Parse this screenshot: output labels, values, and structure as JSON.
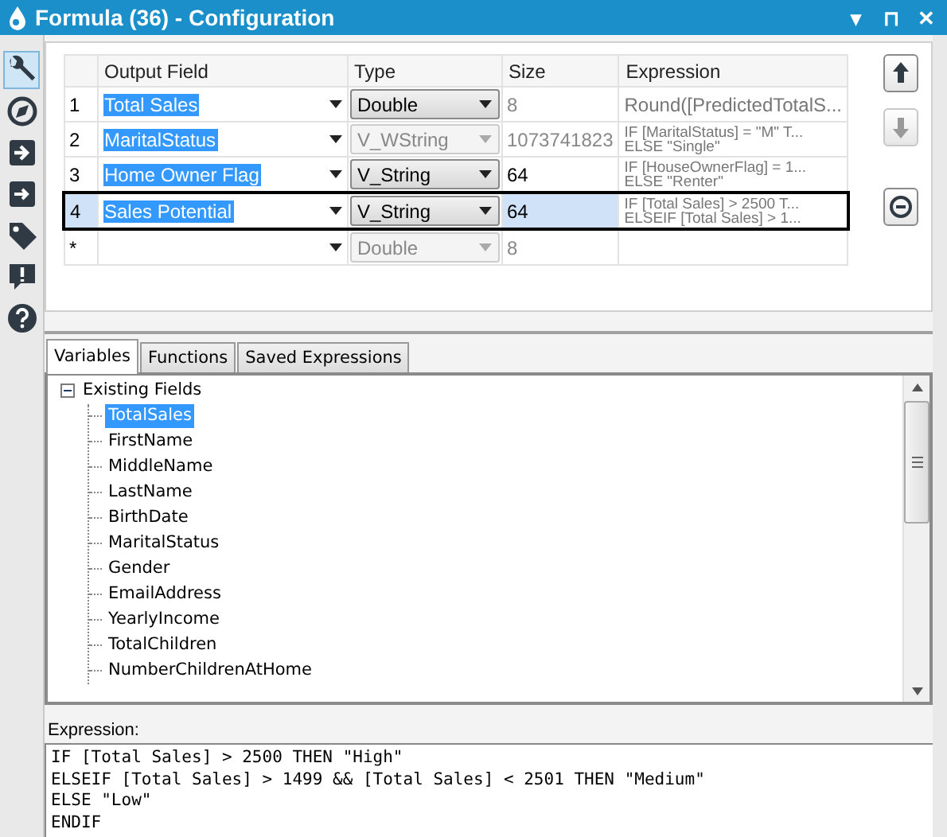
{
  "window": {
    "title": "Formula (36) - Configuration",
    "controls": [
      "▾",
      "⊓",
      "✕"
    ]
  },
  "sidebar": {
    "items": [
      {
        "kind": "wrench",
        "selected": true
      },
      {
        "kind": "compass",
        "selected": false
      },
      {
        "kind": "input",
        "selected": false
      },
      {
        "kind": "output",
        "selected": false
      },
      {
        "kind": "tag",
        "selected": false
      },
      {
        "kind": "alert",
        "selected": false
      },
      {
        "kind": "help",
        "selected": false
      }
    ]
  },
  "table": {
    "columns": [
      "Output Field",
      "Type",
      "Size",
      "Expression"
    ],
    "rows": [
      {
        "number": "1",
        "field": "Total Sales",
        "field_highlighted": true,
        "type": "Double",
        "type_disabled": false,
        "size": "8",
        "size_disabled": true,
        "expression": [
          "Round([PredictedTotalS..."
        ],
        "selected": false
      },
      {
        "number": "2",
        "field": "MaritalStatus",
        "field_highlighted": true,
        "type": "V_WString",
        "type_disabled": true,
        "size": "1073741823",
        "size_disabled": true,
        "expression": [
          "IF [MaritalStatus] = \"M\" T...",
          "ELSE \"Single\""
        ],
        "selected": false
      },
      {
        "number": "3",
        "field": "Home Owner Flag",
        "field_highlighted": true,
        "type": "V_String",
        "type_disabled": false,
        "size": "64",
        "size_disabled": false,
        "expression": [
          "IF [HouseOwnerFlag] = 1...",
          "ELSE \"Renter\""
        ],
        "selected": false
      },
      {
        "number": "4",
        "field": "Sales Potential",
        "field_highlighted": true,
        "type": "V_String",
        "type_disabled": false,
        "size": "64",
        "size_disabled": false,
        "expression": [
          "IF [Total Sales] > 2500 T...",
          "ELSEIF [Total Sales] > 1..."
        ],
        "selected": true
      },
      {
        "number": "*",
        "field": "",
        "field_highlighted": false,
        "type": "Double",
        "type_disabled": true,
        "size": "8",
        "size_disabled": true,
        "expression": [],
        "selected": false
      }
    ]
  },
  "row_buttons": [
    {
      "kind": "up",
      "disabled": false
    },
    {
      "kind": "down",
      "disabled": true
    },
    {
      "kind": "remove",
      "disabled": false
    }
  ],
  "tabs": [
    {
      "label": "Variables",
      "selected": true
    },
    {
      "label": "Functions",
      "selected": false
    },
    {
      "label": "Saved Expressions",
      "selected": false
    }
  ],
  "tree": {
    "label": "Existing Fields",
    "expanded": true,
    "children": [
      {
        "label": "TotalSales",
        "selected": true
      },
      {
        "label": "FirstName",
        "selected": false
      },
      {
        "label": "MiddleName",
        "selected": false
      },
      {
        "label": "LastName",
        "selected": false
      },
      {
        "label": "BirthDate",
        "selected": false
      },
      {
        "label": "MaritalStatus",
        "selected": false
      },
      {
        "label": "Gender",
        "selected": false
      },
      {
        "label": "EmailAddress",
        "selected": false
      },
      {
        "label": "YearlyIncome",
        "selected": false
      },
      {
        "label": "TotalChildren",
        "selected": false
      },
      {
        "label": "NumberChildrenAtHome",
        "selected": false
      }
    ]
  },
  "expression": {
    "label": "Expression:",
    "lines": [
      "IF [Total Sales] > 2500 THEN \"High\"",
      "ELSEIF [Total Sales] > 1499 && [Total Sales] < 2501 THEN \"Medium\"",
      "ELSE \"Low\"",
      "ENDIF"
    ]
  }
}
